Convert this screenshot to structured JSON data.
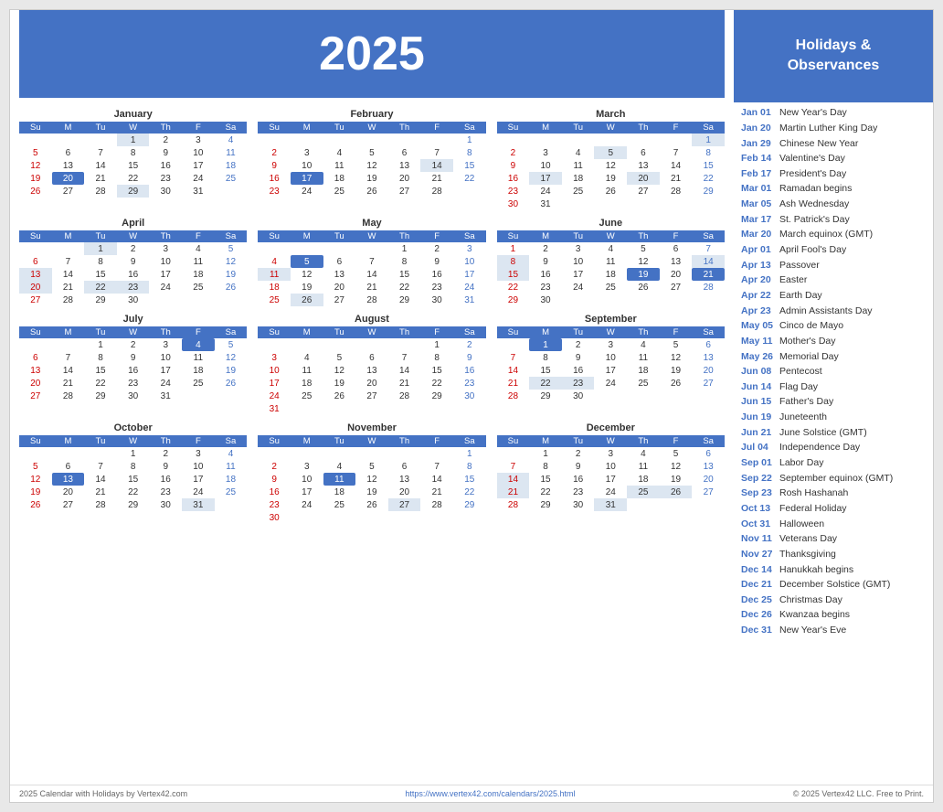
{
  "header": {
    "year": "2025",
    "calendar_title": "2025"
  },
  "sidebar": {
    "title": "Holidays &\nObservances",
    "holidays": [
      {
        "date": "Jan 01",
        "name": "New Year's Day"
      },
      {
        "date": "Jan 20",
        "name": "Martin Luther King Day"
      },
      {
        "date": "Jan 29",
        "name": "Chinese New Year"
      },
      {
        "date": "Feb 14",
        "name": "Valentine's Day"
      },
      {
        "date": "Feb 17",
        "name": "President's Day"
      },
      {
        "date": "Mar 01",
        "name": "Ramadan begins"
      },
      {
        "date": "Mar 05",
        "name": "Ash Wednesday"
      },
      {
        "date": "Mar 17",
        "name": "St. Patrick's Day"
      },
      {
        "date": "Mar 20",
        "name": "March equinox (GMT)"
      },
      {
        "date": "Apr 01",
        "name": "April Fool's Day"
      },
      {
        "date": "Apr 13",
        "name": "Passover"
      },
      {
        "date": "Apr 20",
        "name": "Easter"
      },
      {
        "date": "Apr 22",
        "name": "Earth Day"
      },
      {
        "date": "Apr 23",
        "name": "Admin Assistants Day"
      },
      {
        "date": "May 05",
        "name": "Cinco de Mayo"
      },
      {
        "date": "May 11",
        "name": "Mother's Day"
      },
      {
        "date": "May 26",
        "name": "Memorial Day"
      },
      {
        "date": "Jun 08",
        "name": "Pentecost"
      },
      {
        "date": "Jun 14",
        "name": "Flag Day"
      },
      {
        "date": "Jun 15",
        "name": "Father's Day"
      },
      {
        "date": "Jun 19",
        "name": "Juneteenth"
      },
      {
        "date": "Jun 21",
        "name": "June Solstice (GMT)"
      },
      {
        "date": "Jul 04",
        "name": "Independence Day"
      },
      {
        "date": "Sep 01",
        "name": "Labor Day"
      },
      {
        "date": "Sep 22",
        "name": "September equinox (GMT)"
      },
      {
        "date": "Sep 23",
        "name": "Rosh Hashanah"
      },
      {
        "date": "Oct 13",
        "name": "Federal Holiday"
      },
      {
        "date": "Oct 31",
        "name": "Halloween"
      },
      {
        "date": "Nov 11",
        "name": "Veterans Day"
      },
      {
        "date": "Nov 27",
        "name": "Thanksgiving"
      },
      {
        "date": "Dec 14",
        "name": "Hanukkah begins"
      },
      {
        "date": "Dec 21",
        "name": "December Solstice (GMT)"
      },
      {
        "date": "Dec 25",
        "name": "Christmas Day"
      },
      {
        "date": "Dec 26",
        "name": "Kwanzaa begins"
      },
      {
        "date": "Dec 31",
        "name": "New Year's Eve"
      }
    ]
  },
  "footer": {
    "left": "2025 Calendar with Holidays by Vertex42.com",
    "center": "https://www.vertex42.com/calendars/2025.html",
    "right": "© 2025 Vertex42 LLC. Free to Print."
  },
  "months": [
    {
      "name": "January",
      "days": [
        [
          null,
          null,
          null,
          1,
          2,
          3,
          4
        ],
        [
          5,
          6,
          7,
          8,
          9,
          10,
          11
        ],
        [
          12,
          13,
          14,
          15,
          16,
          17,
          18
        ],
        [
          19,
          20,
          21,
          22,
          23,
          24,
          25
        ],
        [
          26,
          27,
          28,
          29,
          30,
          31,
          null
        ]
      ],
      "highlighted": [
        1,
        20,
        29
      ],
      "today": []
    },
    {
      "name": "February",
      "days": [
        [
          null,
          null,
          null,
          null,
          null,
          null,
          1
        ],
        [
          2,
          3,
          4,
          5,
          6,
          7,
          8
        ],
        [
          9,
          10,
          11,
          12,
          13,
          14,
          15
        ],
        [
          16,
          17,
          18,
          19,
          20,
          21,
          22
        ],
        [
          23,
          24,
          25,
          26,
          27,
          28,
          null
        ]
      ],
      "highlighted": [
        14,
        17
      ],
      "today": []
    },
    {
      "name": "March",
      "days": [
        [
          null,
          null,
          null,
          null,
          null,
          null,
          1
        ],
        [
          2,
          3,
          4,
          5,
          6,
          7,
          8
        ],
        [
          9,
          10,
          11,
          12,
          13,
          14,
          15
        ],
        [
          16,
          17,
          18,
          19,
          20,
          21,
          22
        ],
        [
          23,
          24,
          25,
          26,
          27,
          28,
          29
        ],
        [
          30,
          31,
          null,
          null,
          null,
          null,
          null
        ]
      ],
      "highlighted": [
        1,
        5,
        17,
        20
      ],
      "today": []
    },
    {
      "name": "April",
      "days": [
        [
          null,
          null,
          1,
          2,
          3,
          4,
          5
        ],
        [
          6,
          7,
          8,
          9,
          10,
          11,
          12
        ],
        [
          13,
          14,
          15,
          16,
          17,
          18,
          19
        ],
        [
          20,
          21,
          22,
          23,
          24,
          25,
          26
        ],
        [
          27,
          28,
          29,
          30,
          null,
          null,
          null
        ]
      ],
      "highlighted": [
        1,
        13,
        20,
        22,
        23
      ],
      "today": []
    },
    {
      "name": "May",
      "days": [
        [
          null,
          null,
          null,
          null,
          1,
          2,
          3
        ],
        [
          4,
          5,
          6,
          7,
          8,
          9,
          10
        ],
        [
          11,
          12,
          13,
          14,
          15,
          16,
          17
        ],
        [
          18,
          19,
          20,
          21,
          22,
          23,
          24
        ],
        [
          25,
          26,
          27,
          28,
          29,
          30,
          31
        ]
      ],
      "highlighted": [
        5,
        11,
        26
      ],
      "today": []
    },
    {
      "name": "June",
      "days": [
        [
          1,
          2,
          3,
          4,
          5,
          6,
          7
        ],
        [
          8,
          9,
          10,
          11,
          12,
          13,
          14
        ],
        [
          15,
          16,
          17,
          18,
          19,
          20,
          21
        ],
        [
          22,
          23,
          24,
          25,
          26,
          27,
          28
        ],
        [
          29,
          30,
          null,
          null,
          null,
          null,
          null
        ]
      ],
      "highlighted": [
        8,
        14,
        15,
        19,
        21
      ],
      "today": []
    },
    {
      "name": "July",
      "days": [
        [
          null,
          null,
          1,
          2,
          3,
          4,
          5
        ],
        [
          6,
          7,
          8,
          9,
          10,
          11,
          12
        ],
        [
          13,
          14,
          15,
          16,
          17,
          18,
          19
        ],
        [
          20,
          21,
          22,
          23,
          24,
          25,
          26
        ],
        [
          27,
          28,
          29,
          30,
          31,
          null,
          null
        ]
      ],
      "highlighted": [
        4
      ],
      "today": []
    },
    {
      "name": "August",
      "days": [
        [
          null,
          null,
          null,
          null,
          null,
          1,
          2
        ],
        [
          3,
          4,
          5,
          6,
          7,
          8,
          9
        ],
        [
          10,
          11,
          12,
          13,
          14,
          15,
          16
        ],
        [
          17,
          18,
          19,
          20,
          21,
          22,
          23
        ],
        [
          24,
          25,
          26,
          27,
          28,
          29,
          30
        ],
        [
          31,
          null,
          null,
          null,
          null,
          null,
          null
        ]
      ],
      "highlighted": [],
      "today": []
    },
    {
      "name": "September",
      "days": [
        [
          null,
          1,
          2,
          3,
          4,
          5,
          6
        ],
        [
          7,
          8,
          9,
          10,
          11,
          12,
          13
        ],
        [
          14,
          15,
          16,
          17,
          18,
          19,
          20
        ],
        [
          21,
          22,
          23,
          24,
          25,
          26,
          27
        ],
        [
          28,
          29,
          30,
          null,
          null,
          null,
          null
        ]
      ],
      "highlighted": [
        1,
        22,
        23
      ],
      "today": []
    },
    {
      "name": "October",
      "days": [
        [
          null,
          null,
          null,
          1,
          2,
          3,
          4
        ],
        [
          5,
          6,
          7,
          8,
          9,
          10,
          11
        ],
        [
          12,
          13,
          14,
          15,
          16,
          17,
          18
        ],
        [
          19,
          20,
          21,
          22,
          23,
          24,
          25
        ],
        [
          26,
          27,
          28,
          29,
          30,
          31,
          null
        ]
      ],
      "highlighted": [
        13,
        31
      ],
      "today": []
    },
    {
      "name": "November",
      "days": [
        [
          null,
          null,
          null,
          null,
          null,
          null,
          1
        ],
        [
          2,
          3,
          4,
          5,
          6,
          7,
          8
        ],
        [
          9,
          10,
          11,
          12,
          13,
          14,
          15
        ],
        [
          16,
          17,
          18,
          19,
          20,
          21,
          22
        ],
        [
          23,
          24,
          25,
          26,
          27,
          28,
          29
        ],
        [
          30,
          null,
          null,
          null,
          null,
          null,
          null
        ]
      ],
      "highlighted": [
        11,
        27
      ],
      "today": []
    },
    {
      "name": "December",
      "days": [
        [
          null,
          1,
          2,
          3,
          4,
          5,
          6
        ],
        [
          7,
          8,
          9,
          10,
          11,
          12,
          13
        ],
        [
          14,
          15,
          16,
          17,
          18,
          19,
          20
        ],
        [
          21,
          22,
          23,
          24,
          25,
          26,
          27
        ],
        [
          28,
          29,
          30,
          31,
          null,
          null,
          null
        ]
      ],
      "highlighted": [
        14,
        21,
        25,
        26,
        31
      ],
      "today": []
    }
  ],
  "day_headers": [
    "Su",
    "M",
    "Tu",
    "W",
    "Th",
    "F",
    "Sa"
  ],
  "special_cells": {
    "jan": {
      "blue_bg": [
        20
      ],
      "shaded": [
        1,
        29
      ]
    },
    "feb": {
      "blue_bg": [
        17
      ],
      "shaded": [
        14
      ]
    },
    "mar": {
      "blue_bg": [],
      "shaded": [
        1,
        5,
        17,
        20
      ]
    },
    "apr": {
      "blue_bg": [],
      "shaded": [
        1,
        13,
        20,
        22,
        23
      ]
    },
    "may": {
      "blue_bg": [
        5
      ],
      "shaded": [
        11,
        26
      ]
    },
    "jun": {
      "blue_bg": [
        19,
        21
      ],
      "shaded": [
        8,
        14,
        15
      ]
    },
    "jul": {
      "blue_bg": [
        4
      ],
      "shaded": []
    },
    "aug": {
      "blue_bg": [],
      "shaded": []
    },
    "sep": {
      "blue_bg": [
        1
      ],
      "shaded": [
        22,
        23
      ]
    },
    "oct": {
      "blue_bg": [
        13
      ],
      "shaded": [
        31
      ]
    },
    "nov": {
      "blue_bg": [
        11
      ],
      "shaded": [
        27
      ]
    },
    "dec": {
      "blue_bg": [],
      "shaded": [
        14,
        21,
        25,
        26,
        31
      ]
    }
  }
}
